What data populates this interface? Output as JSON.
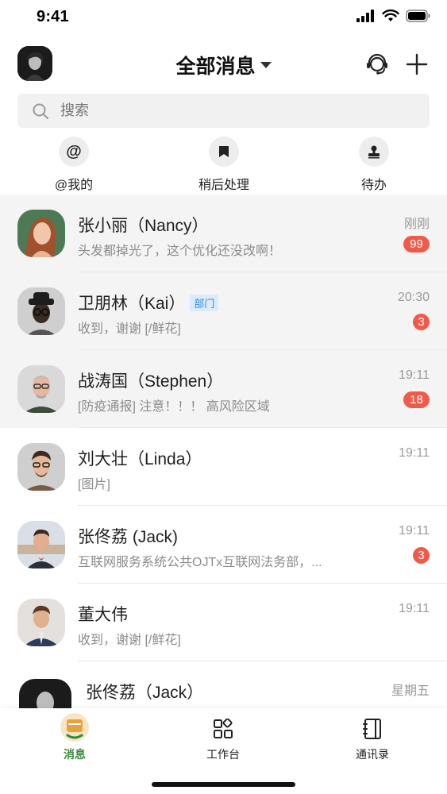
{
  "status_bar": {
    "time": "9:41"
  },
  "header": {
    "title": "全部消息"
  },
  "search": {
    "placeholder": "搜索"
  },
  "quick_actions": [
    {
      "label": "@我的",
      "glyph": "@"
    },
    {
      "label": "稍后处理",
      "icon": "bookmark-icon"
    },
    {
      "label": "待办",
      "icon": "stamp-icon"
    }
  ],
  "conversations": [
    {
      "name": "张小丽（Nancy）",
      "preview": "头发都掉光了，这个优化还没改啊！",
      "time": "刚刚",
      "badge": "99",
      "pinned": true
    },
    {
      "name": "卫朋林（Kai）",
      "tag": "部门",
      "preview": "收到，谢谢 [/鲜花]",
      "time": "20:30",
      "badge": "3",
      "pinned": true
    },
    {
      "name": "战涛国（Stephen）",
      "preview": "[防疫通报] 注意！！！ 高风险区域",
      "time": "19:11",
      "badge": "18",
      "pinned": true
    },
    {
      "name": "刘大壮（Linda）",
      "preview": "[图片]",
      "time": "19:11",
      "pinned": false
    },
    {
      "name": "张佟荔 (Jack)",
      "preview": "互联网服务系统公共OJTx互联网法务部，...",
      "time": "19:11",
      "badge": "3",
      "pinned": false
    },
    {
      "name": "董大伟",
      "preview": "收到，谢谢 [/鲜花]",
      "time": "19:11",
      "pinned": false
    },
    {
      "name": "张佟荔（Jack）",
      "preview": "",
      "time": "星期五",
      "pinned": false
    }
  ],
  "tabbar": [
    {
      "label": "消息",
      "active": true
    },
    {
      "label": "工作台",
      "active": false
    },
    {
      "label": "通讯录",
      "active": false
    }
  ],
  "colors": {
    "accent_green": "#3a8a3a",
    "badge_red": "#f15a4a",
    "tag_blue": "#2f8de4"
  }
}
